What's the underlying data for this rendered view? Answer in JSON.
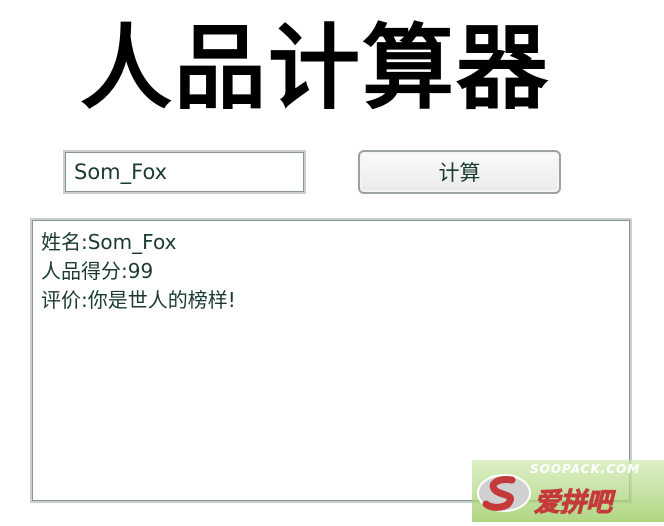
{
  "app": {
    "title": "人品计算器"
  },
  "form": {
    "name_value": "Som_Fox",
    "calc_button_label": "计算"
  },
  "result": {
    "lines": [
      "姓名:Som_Fox",
      "人品得分:99",
      "评价:你是世人的榜样!"
    ]
  },
  "watermark": {
    "url": "SOOPACK.COM",
    "name": "爱拼吧"
  },
  "colors": {
    "text": "#1b3a33",
    "field_border": "#8a9590",
    "background": "#ffffff"
  }
}
